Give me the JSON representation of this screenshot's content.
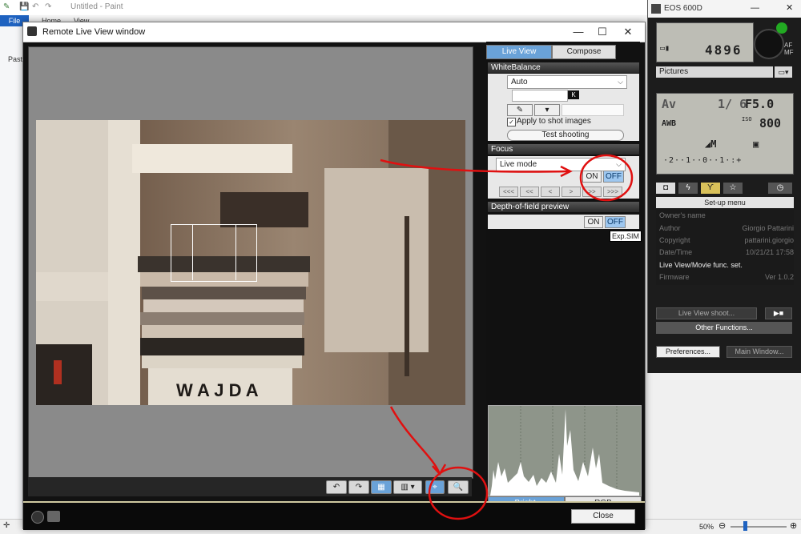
{
  "paint": {
    "title": "Untitled - Paint",
    "tab_file": "File",
    "tab_home": "Home",
    "tab_view": "View",
    "paste": "Paste",
    "zoom": "50%"
  },
  "rlv": {
    "title": "Remote Live View window",
    "tab_live_view": "Live View",
    "tab_compose": "Compose",
    "white_balance": {
      "header": "WhiteBalance",
      "value": "Auto",
      "k_label": "K",
      "apply_label": "Apply to shot images",
      "test_shooting": "Test shooting"
    },
    "focus": {
      "header": "Focus",
      "mode": "Live mode",
      "on": "ON",
      "off": "OFF",
      "nav": [
        "<<<",
        "<<",
        "<",
        ">",
        ">>",
        ">>>"
      ]
    },
    "dof": {
      "header": "Depth-of-field preview",
      "on": "ON",
      "off": "OFF",
      "expsim": "Exp.SIM"
    },
    "hist_bright": "Bright.",
    "hist_rgb": "RGB",
    "close": "Close",
    "photo_text": "W A J D A"
  },
  "eos": {
    "title": "EOS 600D",
    "shots": "4896",
    "pictures": "Pictures",
    "mode": "Av",
    "shutter": "1/ 6",
    "aperture": "F5.0",
    "wb": "AWB",
    "iso_label": "ISO",
    "iso": "800",
    "quality": "◢M",
    "exposure_scale": "·2··1··0··1·:+",
    "setup_menu": "Set-up menu",
    "menu": [
      {
        "key": "Owner's name",
        "val": ""
      },
      {
        "key": "Author",
        "val": "Giorgio Pattarini"
      },
      {
        "key": "Copyright",
        "val": "pattarini.giorgio"
      },
      {
        "key": "Date/Time",
        "val": "10/21/21  17:58"
      },
      {
        "key": "Live View/Movie func. set.",
        "val": ""
      },
      {
        "key": "Firmware",
        "val": "Ver 1.0.2"
      }
    ],
    "live_view_shoot": "Live View shoot...",
    "other_functions": "Other Functions...",
    "preferences": "Preferences...",
    "main_window": "Main Window..."
  },
  "colors": {
    "accent": "#6aa2d8",
    "annotation": "#e01010"
  }
}
